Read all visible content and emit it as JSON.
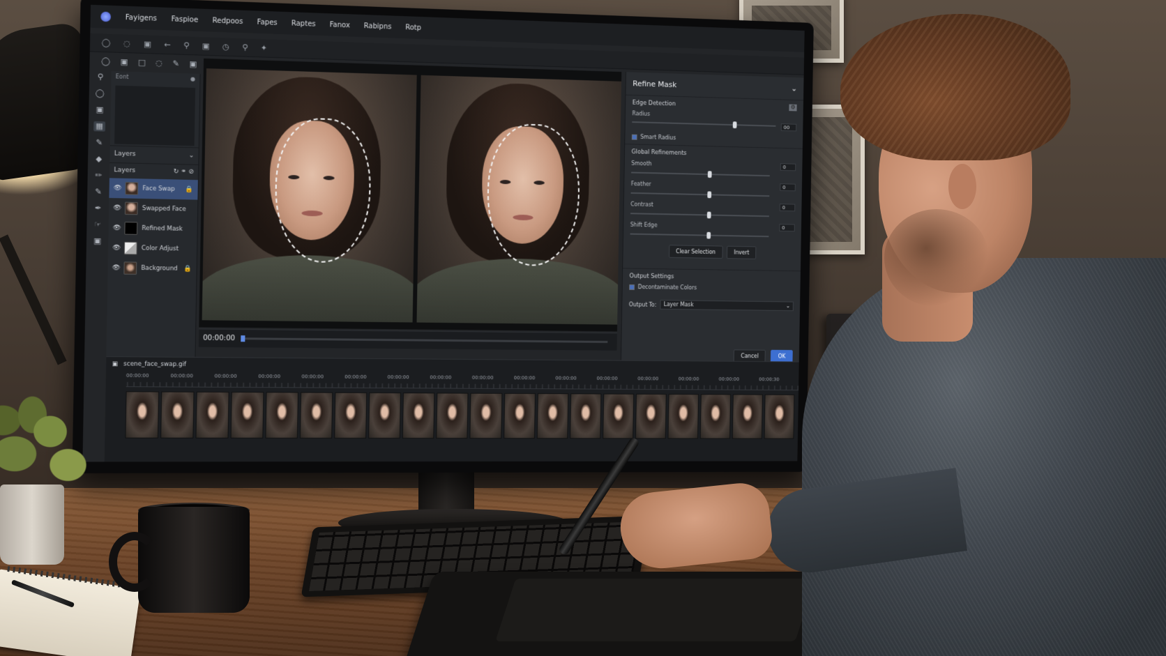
{
  "menubar": {
    "items": [
      "Fayigens",
      "Faspioe",
      "Redpoos",
      "Fapes",
      "Raptes",
      "Fanox",
      "Rabipns",
      "Rotp"
    ]
  },
  "toolbar": {
    "icons": [
      "lasso-icon",
      "brush-icon",
      "stamp-icon",
      "arrow-icon",
      "zoom-icon",
      "lock-icon",
      "clock-icon",
      "search-icon",
      "wand-icon"
    ]
  },
  "left_panel": {
    "preview_title": "Eont",
    "section_title": "Layers",
    "layers_title": "Layers",
    "layers": [
      {
        "name": "Face Swap",
        "thumb": "face",
        "selected": true,
        "locked": true
      },
      {
        "name": "Swapped Face",
        "thumb": "face",
        "selected": false,
        "locked": false
      },
      {
        "name": "Refined Mask",
        "thumb": "mask",
        "selected": false,
        "locked": false
      },
      {
        "name": "Color Adjust",
        "thumb": "adjust",
        "selected": false,
        "locked": false
      },
      {
        "name": "Background",
        "thumb": "bg",
        "selected": false,
        "locked": true
      }
    ]
  },
  "canvas": {
    "timecode": "00:00:00"
  },
  "refine_mask": {
    "title": "Refine Mask",
    "edge_detection": {
      "title": "Edge Detection",
      "radius_label": "Radius",
      "radius_value": "00",
      "radius_level": 0.7,
      "smart_radius_label": "Smart Radius"
    },
    "global_refinements": {
      "title": "Global Refinements",
      "sliders": [
        {
          "label": "Smooth",
          "value": "0",
          "level": 0.55
        },
        {
          "label": "Feather",
          "value": "0",
          "level": 0.55
        },
        {
          "label": "Contrast",
          "value": "0",
          "level": 0.55
        },
        {
          "label": "Shift Edge",
          "value": "0",
          "level": 0.55
        }
      ],
      "clear_selection_label": "Clear Selection",
      "invert_label": "Invert"
    },
    "output_settings": {
      "title": "Output Settings",
      "decontaminate_label": "Decontaminate Colors",
      "output_to_label": "Output To:",
      "output_to_value": "Layer Mask"
    },
    "cancel_label": "Cancel",
    "ok_label": "OK"
  },
  "timeline": {
    "filename": "scene_face_swap.gif",
    "tick_labels": [
      "00:00:00",
      "00:00:00",
      "00:00:00",
      "00:00:00",
      "00:00:00",
      "00:00:00",
      "00:00:00",
      "00:00:00",
      "00:00:00",
      "00:00:00",
      "00:00:00",
      "00:00:00",
      "00:00:00",
      "00:00:00",
      "00:00:00",
      "00:00:30"
    ],
    "frame_count": 20
  }
}
